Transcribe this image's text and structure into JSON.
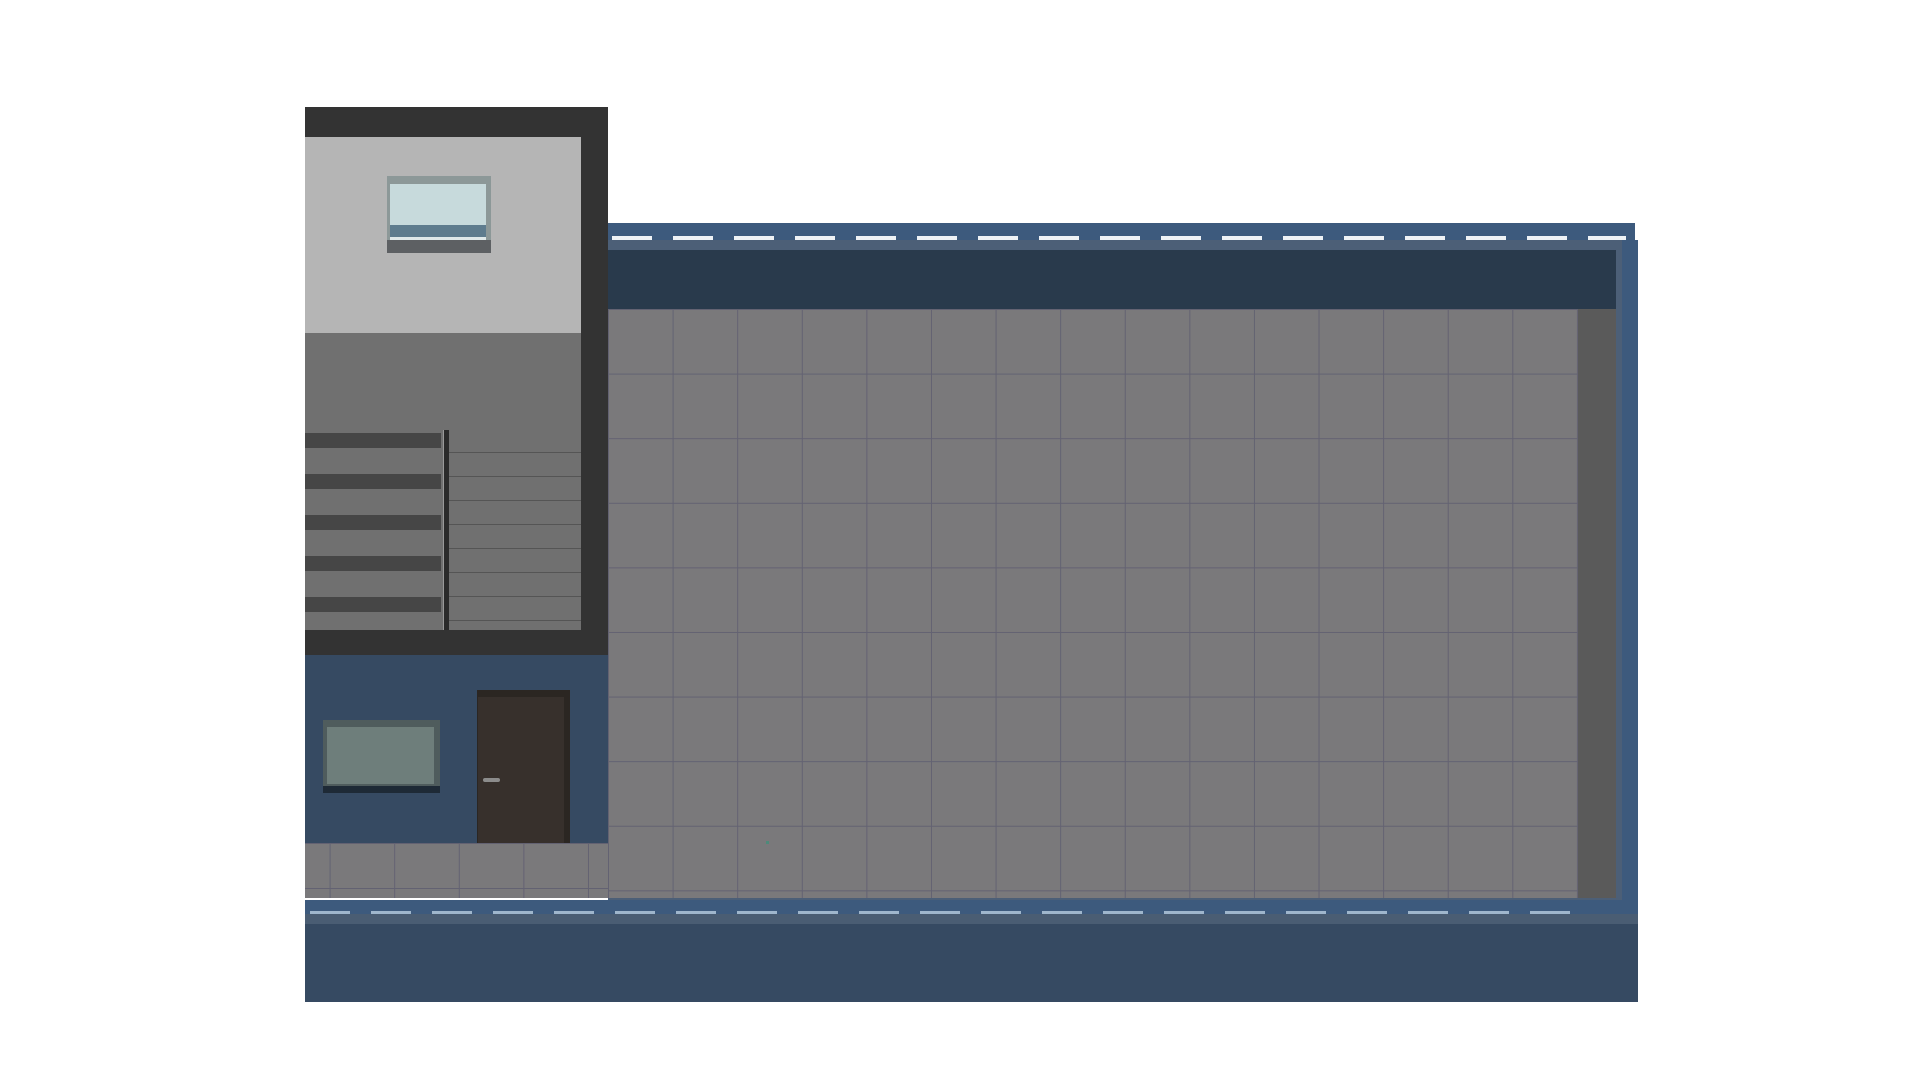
{
  "scene": {
    "description_colors": {
      "background": "#ffffff",
      "building_frame": "#333333",
      "building_wall_upper": "#b5b5b5",
      "building_wall_lower": "#707070",
      "ground_floor": "#364a62",
      "court_floor": "#7a797b",
      "court_trim": "#3d5a7d",
      "door": "#37302c"
    },
    "objects": {
      "upper_window": "window",
      "staircase": "stairs",
      "ground_window": "window",
      "door": "door",
      "court": "tiled-floor"
    }
  }
}
